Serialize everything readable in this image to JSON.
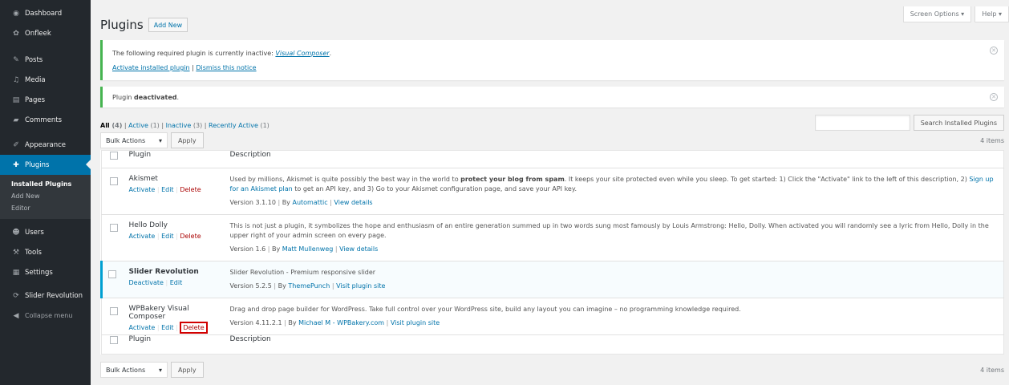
{
  "sidebar": {
    "items": [
      {
        "label": "Dashboard",
        "icon": "dashboard-icon",
        "glyph": "◉"
      },
      {
        "label": "Onfleek",
        "icon": "gear-icon",
        "glyph": "✿"
      },
      {
        "label": "Posts",
        "icon": "pin-icon",
        "glyph": "✎"
      },
      {
        "label": "Media",
        "icon": "media-icon",
        "glyph": "♫"
      },
      {
        "label": "Pages",
        "icon": "pages-icon",
        "glyph": "▤"
      },
      {
        "label": "Comments",
        "icon": "comment-icon",
        "glyph": "▰"
      },
      {
        "label": "Appearance",
        "icon": "brush-icon",
        "glyph": "✐"
      },
      {
        "label": "Plugins",
        "icon": "plug-icon",
        "glyph": "✚"
      },
      {
        "label": "Users",
        "icon": "users-icon",
        "glyph": "☻"
      },
      {
        "label": "Tools",
        "icon": "wrench-icon",
        "glyph": "⚒"
      },
      {
        "label": "Settings",
        "icon": "settings-icon",
        "glyph": "▦"
      },
      {
        "label": "Slider Revolution",
        "icon": "refresh-icon",
        "glyph": "⟳"
      },
      {
        "label": "Collapse menu",
        "icon": "collapse-icon",
        "glyph": "◀"
      }
    ],
    "submenu": [
      "Installed Plugins",
      "Add New",
      "Editor"
    ]
  },
  "screen_options": {
    "label": "Screen Options",
    "help": "Help"
  },
  "header": {
    "title": "Plugins",
    "add_new": "Add New"
  },
  "notice1": {
    "text": "The following required plugin is currently inactive: ",
    "plugin_link": "Visual Composer",
    "period": ".",
    "activate": "Activate installed plugin",
    "sep": " | ",
    "dismiss": "Dismiss this notice"
  },
  "notice2": {
    "text_prefix": "Plugin ",
    "text_bold": "deactivated",
    "text_suffix": "."
  },
  "filters": {
    "all": "All",
    "all_count": "(4)",
    "active": "Active",
    "active_count": "(1)",
    "inactive": "Inactive",
    "inactive_count": "(3)",
    "recent": "Recently Active",
    "recent_count": "(1)",
    "sep": " | "
  },
  "search": {
    "button": "Search Installed Plugins",
    "value": ""
  },
  "bulk": {
    "select": "Bulk Actions",
    "apply": "Apply",
    "count": "4 items"
  },
  "table": {
    "col_plugin": "Plugin",
    "col_description": "Description",
    "rows": [
      {
        "name": "Akismet",
        "actions": [
          "Activate",
          "Edit",
          "Delete"
        ],
        "desc_pre": "Used by millions, Akismet is quite possibly the best way in the world to ",
        "desc_bold": "protect your blog from spam",
        "desc_mid": ". It keeps your site protected even while you sleep. To get started: 1) Click the \"Activate\" link to the left of this description, 2) ",
        "desc_link": "Sign up for an Akismet plan",
        "desc_post": " to get an API key, and 3) Go to your Akismet configuration page, and save your API key.",
        "version": "Version 3.1.10",
        "by": "By",
        "author": "Automattic",
        "details": "View details"
      },
      {
        "name": "Hello Dolly",
        "actions": [
          "Activate",
          "Edit",
          "Delete"
        ],
        "desc": "This is not just a plugin, it symbolizes the hope and enthusiasm of an entire generation summed up in two words sung most famously by Louis Armstrong: Hello, Dolly. When activated you will randomly see a lyric from Hello, Dolly in the upper right of your admin screen on every page.",
        "version": "Version 1.6",
        "by": "By",
        "author": "Matt Mullenweg",
        "details": "View details"
      },
      {
        "name": "Slider Revolution",
        "actions": [
          "Deactivate",
          "Edit"
        ],
        "desc": "Slider Revolution - Premium responsive slider",
        "version": "Version 5.2.5",
        "by": "By",
        "author": "ThemePunch",
        "details": "Visit plugin site"
      },
      {
        "name": "WPBakery Visual Composer",
        "actions": [
          "Activate",
          "Edit",
          "Delete"
        ],
        "desc": "Drag and drop page builder for WordPress. Take full control over your WordPress site, build any layout you can imagine – no programming knowledge required.",
        "version": "Version 4.11.2.1",
        "by": "By",
        "author": "Michael M - WPBakery.com",
        "details": "Visit plugin site"
      }
    ]
  },
  "colors": {
    "sidebar_bg": "#23282d",
    "accent": "#0073aa",
    "notice_green": "#46b450",
    "delete_red": "#a00",
    "highlight_box": "#d10000"
  }
}
